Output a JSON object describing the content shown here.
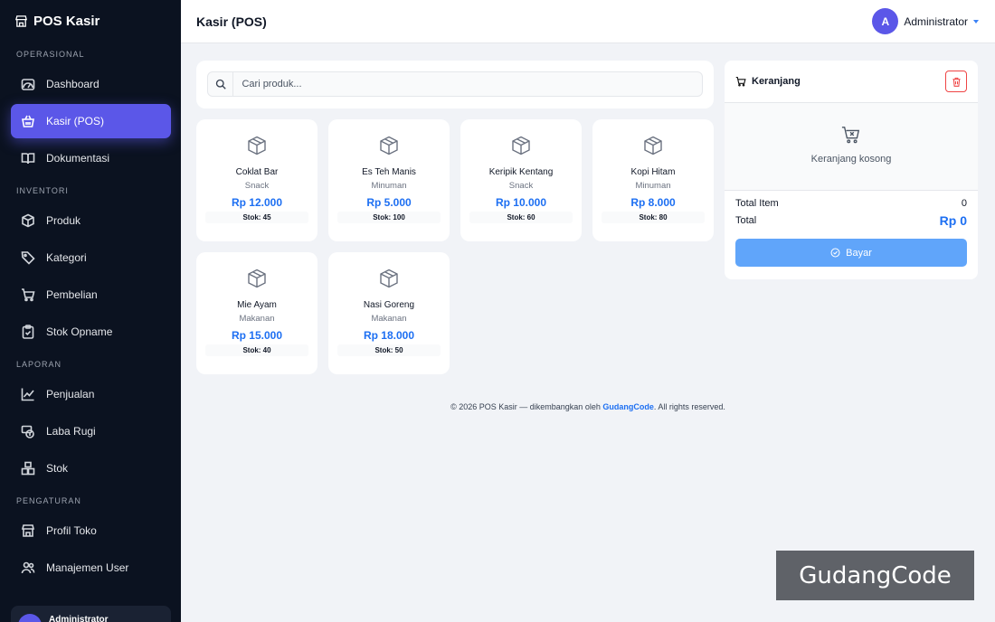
{
  "app": {
    "brand": "POS Kasir"
  },
  "sidebar": {
    "sections": [
      {
        "title": "OPERASIONAL",
        "items": [
          {
            "label": "Dashboard",
            "icon": "gauge-icon"
          },
          {
            "label": "Kasir (POS)",
            "icon": "basket-icon",
            "active": true
          },
          {
            "label": "Dokumentasi",
            "icon": "book-icon"
          }
        ]
      },
      {
        "title": "INVENTORI",
        "items": [
          {
            "label": "Produk",
            "icon": "box-icon"
          },
          {
            "label": "Kategori",
            "icon": "tag-icon"
          },
          {
            "label": "Pembelian",
            "icon": "cart-icon"
          },
          {
            "label": "Stok Opname",
            "icon": "clipboard-check-icon"
          }
        ]
      },
      {
        "title": "LAPORAN",
        "items": [
          {
            "label": "Penjualan",
            "icon": "line-chart-icon"
          },
          {
            "label": "Laba Rugi",
            "icon": "cash-icon"
          },
          {
            "label": "Stok",
            "icon": "boxes-icon"
          }
        ]
      },
      {
        "title": "PENGATURAN",
        "items": [
          {
            "label": "Profil Toko",
            "icon": "shop-icon"
          },
          {
            "label": "Manajemen User",
            "icon": "users-icon"
          }
        ]
      }
    ],
    "user_name": "Administrator"
  },
  "topbar": {
    "title": "Kasir (POS)",
    "user_initial": "A",
    "user_name": "Administrator"
  },
  "search": {
    "placeholder": "Cari produk..."
  },
  "products": [
    {
      "name": "Coklat Bar",
      "category": "Snack",
      "price": "Rp 12.000",
      "stock": "Stok: 45"
    },
    {
      "name": "Es Teh Manis",
      "category": "Minuman",
      "price": "Rp 5.000",
      "stock": "Stok: 100"
    },
    {
      "name": "Keripik Kentang",
      "category": "Snack",
      "price": "Rp 10.000",
      "stock": "Stok: 60"
    },
    {
      "name": "Kopi Hitam",
      "category": "Minuman",
      "price": "Rp 8.000",
      "stock": "Stok: 80"
    },
    {
      "name": "Mie Ayam",
      "category": "Makanan",
      "price": "Rp 15.000",
      "stock": "Stok: 40"
    },
    {
      "name": "Nasi Goreng",
      "category": "Makanan",
      "price": "Rp 18.000",
      "stock": "Stok: 50"
    }
  ],
  "cart": {
    "title": "Keranjang",
    "empty_text": "Keranjang kosong",
    "total_item_label": "Total Item",
    "total_item_value": "0",
    "total_label": "Total",
    "total_value": "Rp 0",
    "pay_label": "Bayar"
  },
  "footer": {
    "prefix": "© 2026 POS Kasir — dikembangkan oleh ",
    "link": "GudangCode",
    "suffix": ". All rights reserved."
  },
  "watermark": "GudangCode",
  "colors": {
    "accent": "#5b57e8",
    "price": "#1d6ff2",
    "sidebar_bg": "#0b1220",
    "pay_button": "#60a5fa",
    "danger": "#ef4444"
  }
}
